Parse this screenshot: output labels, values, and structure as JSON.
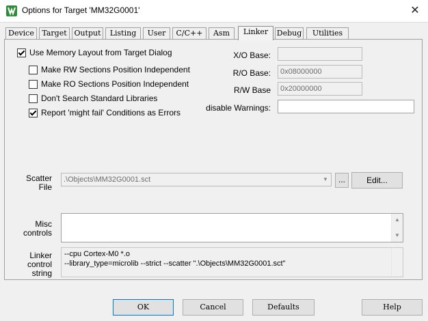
{
  "window": {
    "title": "Options for Target 'MM32G0001'",
    "close_glyph": "✕"
  },
  "tabs": [
    {
      "label": "Device"
    },
    {
      "label": "Target"
    },
    {
      "label": "Output"
    },
    {
      "label": "Listing"
    },
    {
      "label": "User"
    },
    {
      "label": "C/C++"
    },
    {
      "label": "Asm"
    },
    {
      "label": "Linker",
      "active": true
    },
    {
      "label": "Debug"
    },
    {
      "label": "Utilities"
    }
  ],
  "linker": {
    "use_memory_layout": {
      "label": "Use Memory Layout from Target Dialog",
      "checked": true
    },
    "rw_independent": {
      "label": "Make RW Sections Position Independent",
      "checked": false
    },
    "ro_independent": {
      "label": "Make RO Sections Position Independent",
      "checked": false
    },
    "dont_search_std": {
      "label": "Don't Search Standard Libraries",
      "checked": false
    },
    "might_fail_errors": {
      "label": "Report 'might fail' Conditions as Errors",
      "checked": true
    },
    "xo_base": {
      "label": "X/O Base:",
      "value": ""
    },
    "ro_base": {
      "label": "R/O Base:",
      "value": "0x08000000"
    },
    "rw_base": {
      "label": "R/W Base",
      "value": "0x20000000"
    },
    "disable_warnings": {
      "label": "disable Warnings:",
      "value": ""
    },
    "scatter": {
      "label_line1": "Scatter",
      "label_line2": "File",
      "value": ".\\Objects\\MM32G0001.sct",
      "browse_label": "...",
      "edit_label": "Edit..."
    },
    "misc": {
      "label_line1": "Misc",
      "label_line2": "controls",
      "value": ""
    },
    "control_string": {
      "label_line1": "Linker",
      "label_line2": "control",
      "label_line3": "string",
      "line1": "--cpu Cortex-M0 *.o",
      "line2": "--library_type=microlib --strict --scatter \".\\Objects\\MM32G0001.sct\""
    }
  },
  "footer": {
    "ok_label": "OK",
    "cancel_label": "Cancel",
    "defaults_label": "Defaults",
    "help_label": "Help"
  }
}
